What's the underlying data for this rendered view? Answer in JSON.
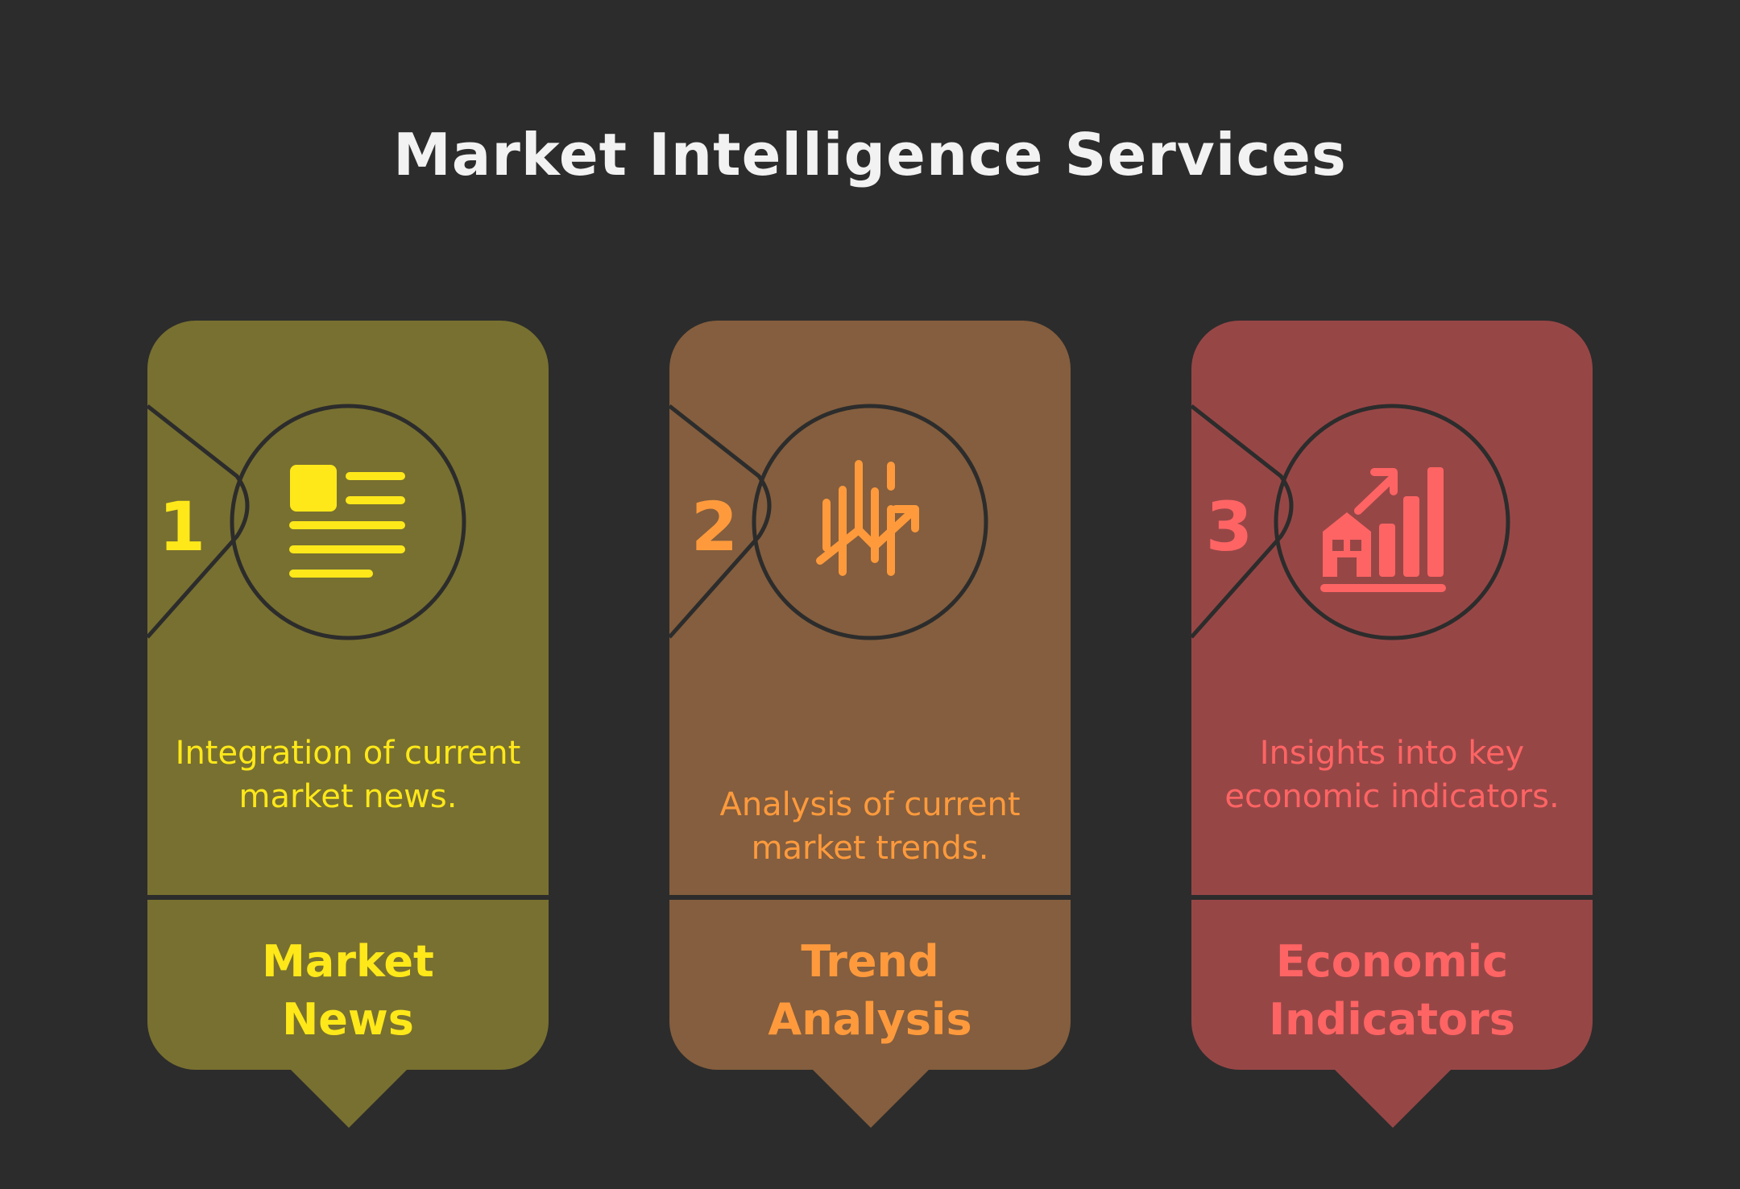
{
  "title": "Market Intelligence Services",
  "cards": [
    {
      "number": "1",
      "description": "Integration of current market news.",
      "label_line1": "Market",
      "label_line2": "News",
      "icon": "newspaper-icon",
      "panel_color": "#787030",
      "accent_color": "#ffe819"
    },
    {
      "number": "2",
      "description": "Analysis of current market trends.",
      "label_line1": "Trend",
      "label_line2": "Analysis",
      "icon": "trend-chart-icon",
      "panel_color": "#845e3e",
      "accent_color": "#ff9a3c"
    },
    {
      "number": "3",
      "description": "Insights into key economic indicators.",
      "label_line1": "Economic",
      "label_line2": "Indicators",
      "icon": "economic-growth-icon",
      "panel_color": "#974646",
      "accent_color": "#ff6464"
    }
  ]
}
